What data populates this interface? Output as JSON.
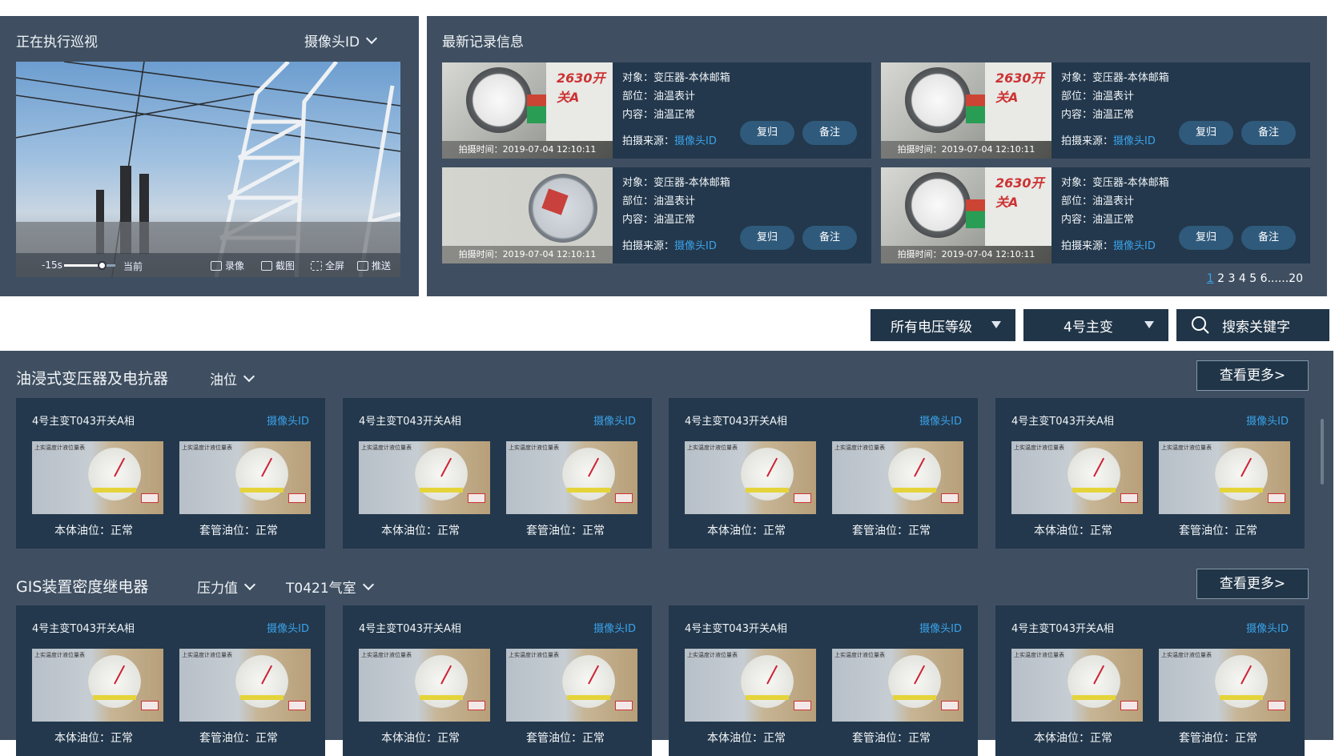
{
  "patrol": {
    "title": "正在执行巡视",
    "camera_select": "摄像头ID",
    "timeline_start": "-15s",
    "timeline_now": "当前",
    "record": "录像",
    "screenshot": "截图",
    "fullscreen": "全屏",
    "push": "推送",
    "timeline_progress": 0.75
  },
  "latest": {
    "title": "最新记录信息",
    "records": [
      {
        "time": "拍摄时间：2019-07-04 12:10:11",
        "object": "对象：变压器-本体邮箱",
        "part": "部位：油温表计",
        "content": "内容：油温正常",
        "source_label": "拍摄来源：",
        "source_link": "摄像头ID",
        "btn_reset": "复归",
        "btn_note": "备注",
        "overlay": "2630开关A"
      },
      {
        "time": "拍摄时间：2019-07-04 12:10:11",
        "object": "对象：变压器-本体邮箱",
        "part": "部位：油温表计",
        "content": "内容：油温正常",
        "source_label": "拍摄来源：",
        "source_link": "摄像头ID",
        "btn_reset": "复归",
        "btn_note": "备注",
        "overlay": "2630开关A"
      },
      {
        "time": "拍摄时间：2019-07-04 12:10:11",
        "object": "对象：变压器-本体邮箱",
        "part": "部位：油温表计",
        "content": "内容：油温正常",
        "source_label": "拍摄来源：",
        "source_link": "摄像头ID",
        "btn_reset": "复归",
        "btn_note": "备注",
        "overlay": ""
      },
      {
        "time": "拍摄时间：2019-07-04 12:10:11",
        "object": "对象：变压器-本体邮箱",
        "part": "部位：油温表计",
        "content": "内容：油温正常",
        "source_label": "拍摄来源：",
        "source_link": "摄像头ID",
        "btn_reset": "复归",
        "btn_note": "备注",
        "overlay": "2630开关A"
      }
    ],
    "pager": {
      "current": "1",
      "rest": "2 3 4 5 6......20"
    }
  },
  "filters": {
    "voltage": "所有电压等级",
    "transformer": "4号主变",
    "search": "搜索关键字"
  },
  "section1": {
    "title": "油浸式变压器及电抗器",
    "select1": "油位",
    "more": "查看更多>",
    "cards": [
      {
        "name": "4号主变T043开关A相",
        "link": "摄像头ID",
        "label1": "本体油位：正常",
        "label2": "套管油位：正常"
      },
      {
        "name": "4号主变T043开关A相",
        "link": "摄像头ID",
        "label1": "本体油位：正常",
        "label2": "套管油位：正常"
      },
      {
        "name": "4号主变T043开关A相",
        "link": "摄像头ID",
        "label1": "本体油位：正常",
        "label2": "套管油位：正常"
      },
      {
        "name": "4号主变T043开关A相",
        "link": "摄像头ID",
        "label1": "本体油位：正常",
        "label2": "套管油位：正常"
      }
    ]
  },
  "section2": {
    "title": "GIS装置密度继电器",
    "select1": "压力值",
    "select2": "T0421气室",
    "more": "查看更多>",
    "cards": [
      {
        "name": "4号主变T043开关A相",
        "link": "摄像头ID",
        "label1": "本体油位：正常",
        "label2": "套管油位：正常"
      },
      {
        "name": "4号主变T043开关A相",
        "link": "摄像头ID",
        "label1": "本体油位：正常",
        "label2": "套管油位：正常"
      },
      {
        "name": "4号主变T043开关A相",
        "link": "摄像头ID",
        "label1": "本体油位：正常",
        "label2": "套管油位：正常"
      },
      {
        "name": "4号主变T043开关A相",
        "link": "摄像头ID",
        "label1": "本体油位：正常",
        "label2": "套管油位：正常"
      }
    ]
  },
  "gauge_caption": "上实温度计液位量表"
}
